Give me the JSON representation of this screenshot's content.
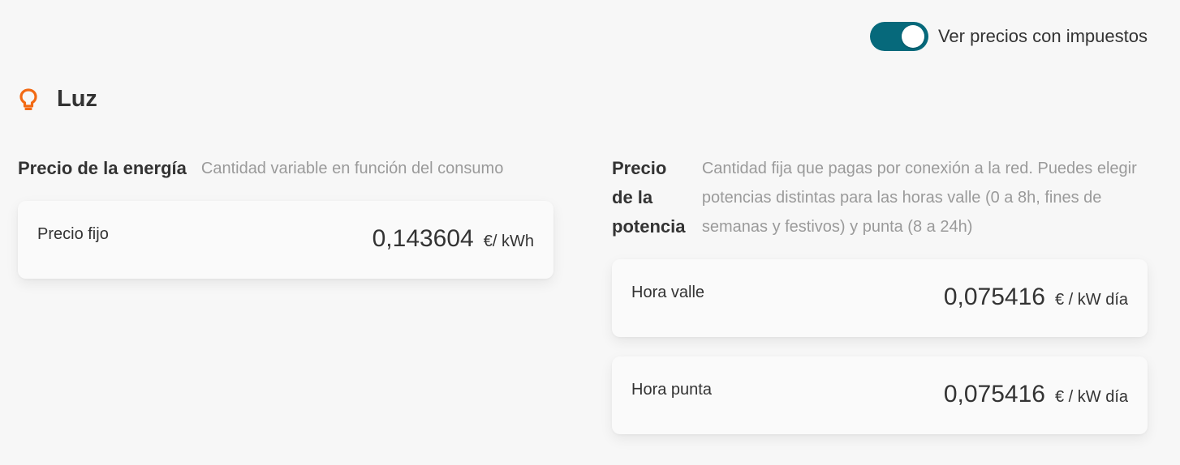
{
  "tax_toggle": {
    "label": "Ver precios con impuestos",
    "on": true,
    "color": "#06697b"
  },
  "section": {
    "title": "Luz",
    "icon": "lightbulb-icon",
    "icon_color": "#f26a14"
  },
  "energy": {
    "title": "Precio de la energía",
    "description": "Cantidad variable en función del consumo",
    "cards": [
      {
        "label": "Precio fijo",
        "value": "0,143604",
        "unit": "€/ kWh"
      }
    ]
  },
  "power": {
    "title": "Precio de la potencia",
    "description": "Cantidad fija que pagas por conexión a la red. Puedes elegir potencias distintas para las horas valle (0 a 8h, fines de semanas y festivos) y punta (8 a 24h)",
    "cards": [
      {
        "label": "Hora valle",
        "value": "0,075416",
        "unit": "€ / kW día"
      },
      {
        "label": "Hora punta",
        "value": "0,075416",
        "unit": "€ / kW día"
      }
    ]
  }
}
